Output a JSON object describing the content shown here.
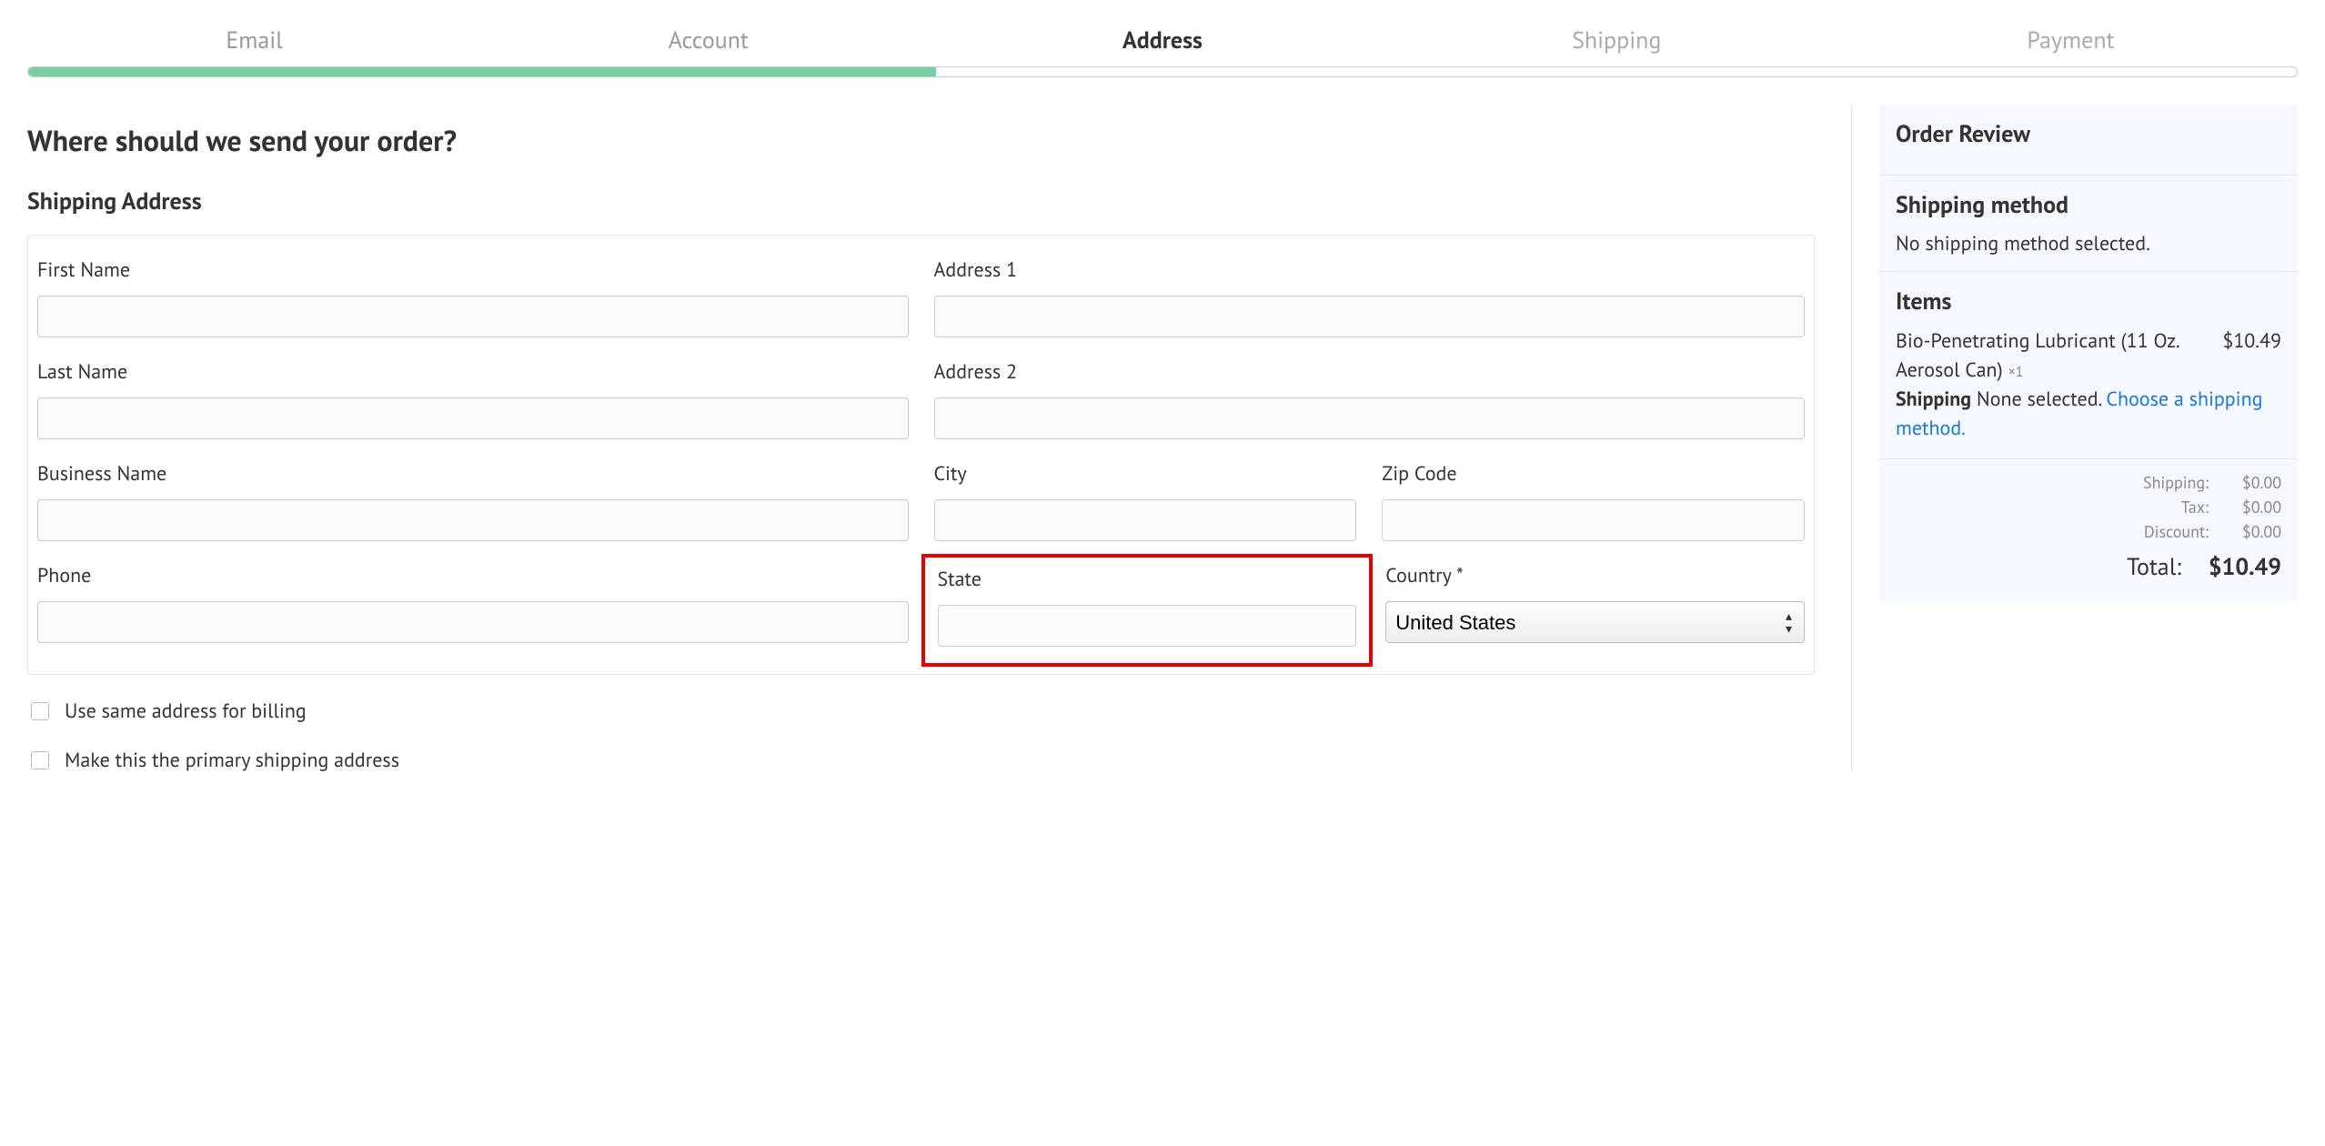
{
  "steps": {
    "items": [
      {
        "label": "Email",
        "state": "done"
      },
      {
        "label": "Account",
        "state": "done"
      },
      {
        "label": "Address",
        "state": "current"
      },
      {
        "label": "Shipping",
        "state": "upcoming"
      },
      {
        "label": "Payment",
        "state": "upcoming"
      }
    ],
    "progress_percent": 40
  },
  "page": {
    "title": "Where should we send your order?",
    "section_title": "Shipping Address"
  },
  "form": {
    "first_name_label": "First Name",
    "last_name_label": "Last Name",
    "business_label": "Business Name",
    "phone_label": "Phone",
    "address1_label": "Address 1",
    "address2_label": "Address 2",
    "city_label": "City",
    "zip_label": "Zip Code",
    "state_label": "State",
    "country_label": "Country *",
    "country_value": "United States",
    "same_billing_label": "Use same address for billing",
    "primary_addr_label": "Make this the primary shipping address"
  },
  "review": {
    "title": "Order Review",
    "shipping_method_title": "Shipping method",
    "shipping_method_text": "No shipping method selected.",
    "items_title": "Items",
    "item_name": "Bio-Penetrating Lubricant (11 Oz. Aerosol Can)",
    "item_qty": "×1",
    "item_price": "$10.49",
    "shipping_label": "Shipping",
    "shipping_value": "None selected.",
    "choose_link": "Choose a shipping method.",
    "totals": {
      "shipping_label": "Shipping:",
      "shipping_value": "$0.00",
      "tax_label": "Tax:",
      "tax_value": "$0.00",
      "discount_label": "Discount:",
      "discount_value": "$0.00",
      "total_label": "Total:",
      "total_value": "$10.49"
    }
  }
}
